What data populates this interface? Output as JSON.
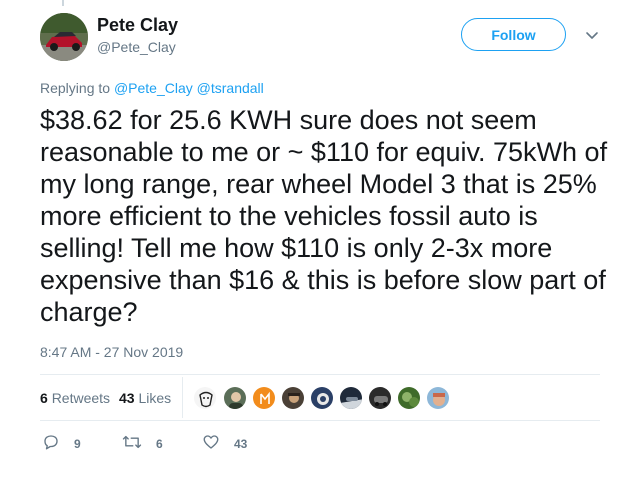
{
  "tweet": {
    "author_name": "Pete Clay",
    "author_handle": "@Pete_Clay",
    "follow_label": "Follow",
    "replying_prefix": "Replying to",
    "replying_mentions": [
      "@Pete_Clay",
      "@tsrandall"
    ],
    "text": "$38.62 for 25.6 KWH sure does not seem reasonable to me or ~ $110 for equiv. 75kWh of my long range, rear wheel Model 3 that is 25% more efficient to the vehicles fossil auto is selling! Tell me how $110 is only 2-3x more expensive than $16 & this is before slow part of charge?",
    "timestamp": "8:47 AM - 27 Nov 2019"
  },
  "stats": {
    "retweets_count": "6",
    "retweets_label": "Retweets",
    "likes_count": "43",
    "likes_label": "Likes"
  },
  "likers": [
    {
      "name": "liker-avatar-1",
      "color": "#f5f5f5",
      "accent": "#222222"
    },
    {
      "name": "liker-avatar-2",
      "color": "#5b6e58",
      "accent": "#e2c7a8"
    },
    {
      "name": "liker-avatar-3",
      "color": "#f28c1c",
      "accent": "#ffffff"
    },
    {
      "name": "liker-avatar-4",
      "color": "#4a4036",
      "accent": "#c9a27a"
    },
    {
      "name": "liker-avatar-5",
      "color": "#2a3f66",
      "accent": "#e8e8e8"
    },
    {
      "name": "liker-avatar-6",
      "color": "#1f2a3a",
      "accent": "#d0d6dc"
    },
    {
      "name": "liker-avatar-7",
      "color": "#2b2b2b",
      "accent": "#7a7a7a"
    },
    {
      "name": "liker-avatar-8",
      "color": "#3f6b2a",
      "accent": "#8fb36a"
    },
    {
      "name": "liker-avatar-9",
      "color": "#8db7d8",
      "accent": "#c9684a"
    }
  ],
  "actions": {
    "reply_count": "9",
    "retweet_count": "6",
    "like_count": "43"
  },
  "icons": {
    "caret": "chevron-down-icon",
    "reply": "reply-icon",
    "retweet": "retweet-icon",
    "like": "heart-icon"
  },
  "colors": {
    "accent": "#1da1f2",
    "secondary_text": "#657786",
    "primary_text": "#14171a",
    "divider": "#e6ecf0"
  }
}
